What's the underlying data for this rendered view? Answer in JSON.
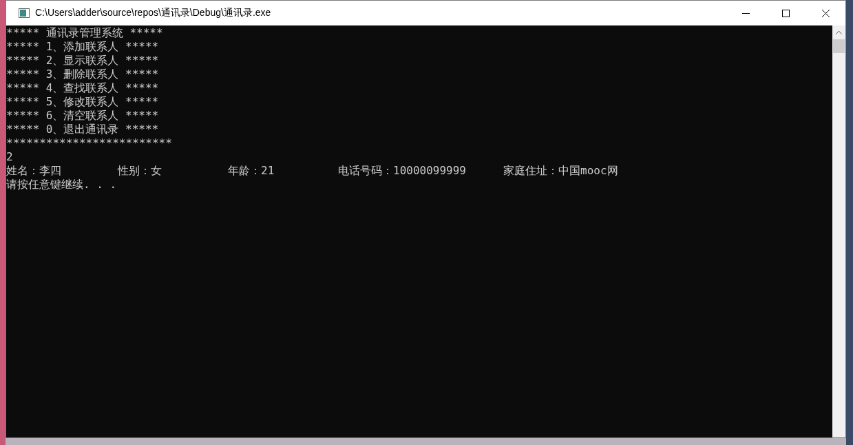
{
  "window": {
    "title": "C:\\Users\\adder\\source\\repos\\通讯录\\Debug\\通讯录.exe"
  },
  "console": {
    "lines": [
      "***** 通讯录管理系统 *****",
      "***** 1、添加联系人 *****",
      "***** 2、显示联系人 *****",
      "***** 3、删除联系人 *****",
      "***** 4、查找联系人 *****",
      "***** 5、修改联系人 *****",
      "***** 6、清空联系人 *****",
      "***** 0、退出通讯录 *****",
      "*************************",
      "2"
    ],
    "record": [
      "姓名：李四",
      "性别：女",
      "年龄：21",
      "电话号码：10000099999",
      "家庭住址：中国mooc网"
    ],
    "prompt": "请按任意键继续. . ."
  }
}
